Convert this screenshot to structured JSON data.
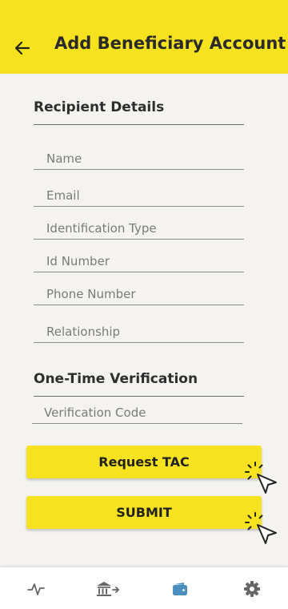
{
  "header": {
    "title": "Add Beneficiary Account",
    "back_icon": "arrow-left-icon"
  },
  "recipient": {
    "section_title": "Recipient Details",
    "fields": {
      "name": {
        "placeholder": "Name",
        "value": ""
      },
      "email": {
        "placeholder": "Email",
        "value": ""
      },
      "id_type": {
        "placeholder": "Identification Type",
        "value": ""
      },
      "id_number": {
        "placeholder": "Id Number",
        "value": ""
      },
      "phone": {
        "placeholder": "Phone Number",
        "value": ""
      },
      "relationship": {
        "placeholder": "Relationship",
        "value": ""
      }
    }
  },
  "verification": {
    "section_title": "One-Time Verification",
    "code": {
      "placeholder": "Verification Code",
      "value": ""
    }
  },
  "buttons": {
    "request_tac": "Request TAC",
    "submit": "SUBMIT"
  },
  "nav": {
    "items": [
      {
        "icon": "activity-icon",
        "active": false
      },
      {
        "icon": "bank-transfer-icon",
        "active": false
      },
      {
        "icon": "wallet-icon",
        "active": true
      },
      {
        "icon": "gear-icon",
        "active": false
      }
    ]
  },
  "colors": {
    "brand_yellow": "#f6e21f",
    "background": "#f4f3f0",
    "nav_active": "#4a8fc0",
    "nav_inactive": "#666666"
  }
}
